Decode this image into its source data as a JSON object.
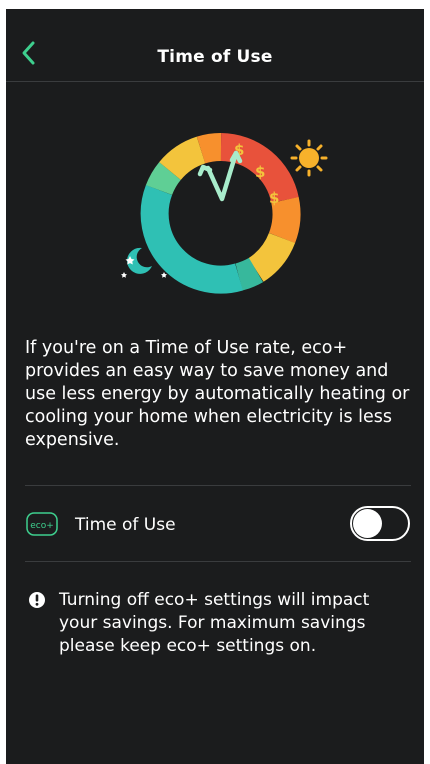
{
  "header": {
    "title": "Time of Use",
    "back_icon": "chevron-left-icon",
    "accent_color": "#3ecf8e"
  },
  "illustration": {
    "icons": [
      "clock-ring",
      "sun-icon",
      "moon-icon",
      "dollar-icon"
    ],
    "segment_colors": [
      "#e8523b",
      "#f7902d",
      "#f3c43c",
      "#37b89c",
      "#2fc0b4"
    ]
  },
  "description": "If you're on a Time of Use rate, eco+ provides an easy way to save money and use less energy by automatically heating or cooling your home when electricity is less expensive.",
  "setting": {
    "icon_label": "eco+",
    "label": "Time of Use",
    "enabled": false
  },
  "warning": {
    "icon": "exclamation-icon",
    "text": "Turning off eco+ settings will impact your savings. For maximum savings please keep eco+ settings on."
  }
}
